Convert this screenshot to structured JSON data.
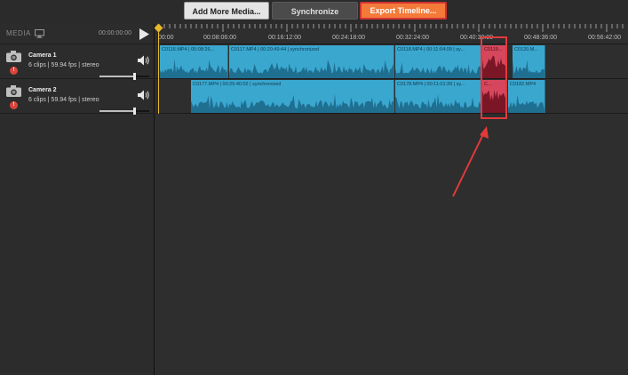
{
  "toolbar": {
    "add_media_label": "Add More Media...",
    "synchronize_label": "Synchronize",
    "export_label": "Export Timeline..."
  },
  "media_panel": {
    "title": "MEDIA",
    "timecode": "00:00:00:00"
  },
  "tracks": [
    {
      "name": "Camera 1",
      "info": "6 clips  |  59.94 fps  |  stereo",
      "badge": "!",
      "volume": 0.7
    },
    {
      "name": "Camera 2",
      "info": "6 clips  |  59.94 fps  |  stereo",
      "badge": "!",
      "volume": 0.7
    }
  ],
  "ruler": {
    "ticks": [
      "00:00",
      "00:08:06:00",
      "00:16:12:00",
      "00:24:18:00",
      "00:32:24:00",
      "00:40:30:00",
      "00:48:36:00",
      "00:56:42:00"
    ]
  },
  "clips": {
    "camera1": [
      {
        "label": "C0116.MP4 | 00:08:26...",
        "selected": false
      },
      {
        "label": "C0117.MP4 | 00:20:49:44 | synchronized",
        "selected": false
      },
      {
        "label": "C0118.MP4 | 00:11:04:09 | sy...",
        "selected": false
      },
      {
        "label": "C0119...",
        "selected": true
      },
      {
        "label": "C0120.M...",
        "selected": false
      }
    ],
    "camera2": [
      {
        "label": "C0177.MP4 | 00:25:40:02 | synchronized",
        "selected": false
      },
      {
        "label": "C0178.MP4 | 00:11:01:39 | sy...",
        "selected": false
      },
      {
        "label": "C...",
        "selected": true
      },
      {
        "label": "C0182.MP4",
        "selected": false
      }
    ]
  },
  "colors": {
    "clip": "#3aa7cf",
    "clip_selected": "#d6475d",
    "export_button": "#f47a3a",
    "highlight": "#e23a3a",
    "playhead": "#e6b92a"
  }
}
